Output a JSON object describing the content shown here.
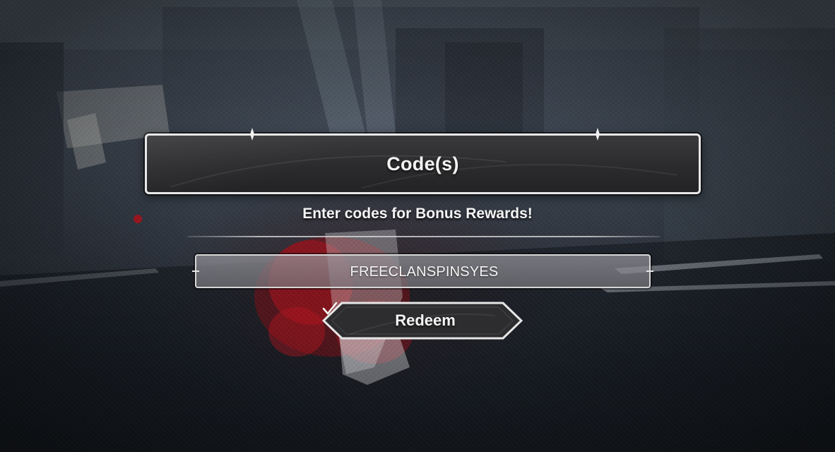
{
  "dialog": {
    "title": "Code(s)",
    "subtitle": "Enter codes for Bonus Rewards!"
  },
  "code_input": {
    "value": "FREECLANSPINSYES"
  },
  "redeem_button": {
    "label": "Redeem",
    "icon": "check-icon"
  },
  "colors": {
    "panel_border": "#e8e8e8",
    "panel_fill": "#2b2b2d",
    "input_fill": "#8c8c92",
    "text": "#f2f2f2",
    "accent_blood": "#b4141e"
  }
}
